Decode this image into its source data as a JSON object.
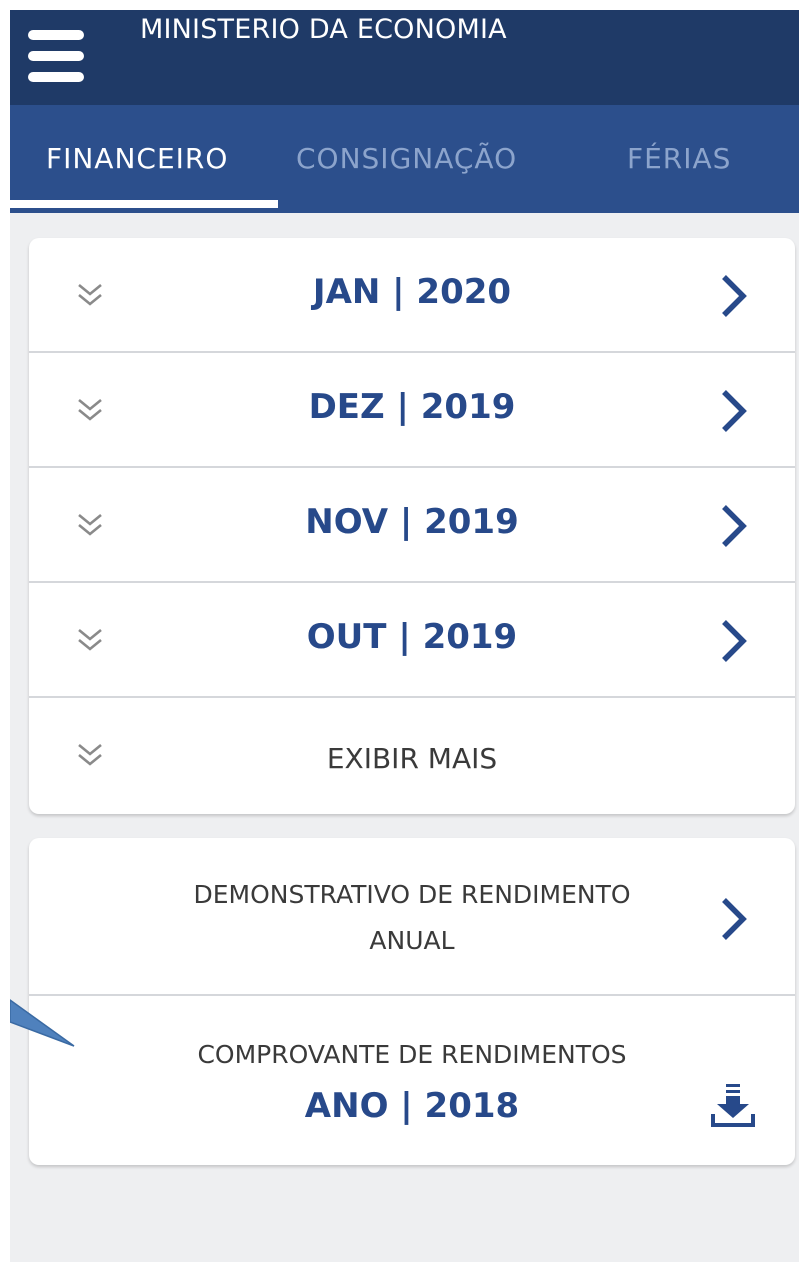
{
  "header": {
    "title": "MINISTERIO DA ECONOMIA",
    "menu_icon": "hamburger-menu-icon"
  },
  "tabs": [
    {
      "label": "FINANCEIRO",
      "active": true
    },
    {
      "label": "CONSIGNAÇÃO",
      "active": false
    },
    {
      "label": "FÉRIAS",
      "active": false
    }
  ],
  "months": [
    {
      "label": "JAN | 2020"
    },
    {
      "label": "DEZ | 2019"
    },
    {
      "label": "NOV | 2019"
    },
    {
      "label": "OUT | 2019"
    }
  ],
  "show_more": {
    "label": "EXIBIR MAIS"
  },
  "annual_statement": {
    "line1": "DEMONSTRATIVO DE RENDIMENTO",
    "line2": "ANUAL"
  },
  "income_receipt": {
    "title": "COMPROVANTE DE RENDIMENTOS",
    "year": "ANO | 2018",
    "icon": "download-icon"
  },
  "colors": {
    "header_bg": "#1f3a67",
    "tabbar_bg": "#2c4f8c",
    "accent": "#27498a",
    "tab_inactive": "#8ca4cc",
    "screen_bg": "#eeeff1"
  }
}
